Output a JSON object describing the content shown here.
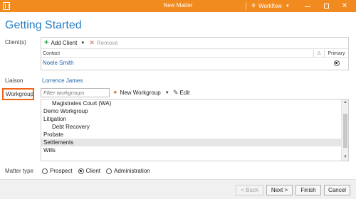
{
  "window": {
    "title": "New Matter",
    "workflow_label": "Workflow",
    "app_icon": "book-icon"
  },
  "page": {
    "heading": "Getting Started"
  },
  "clients": {
    "label": "Client(s)",
    "add_label": "Add Client",
    "remove_label": "Remove",
    "col_contact": "Contact",
    "col_warning": "⚠",
    "col_primary": "Primary",
    "rows": [
      {
        "name": "Noele Smith",
        "primary": true
      }
    ]
  },
  "liaison": {
    "label": "Liaison",
    "value": "Lorrence James"
  },
  "workgroup": {
    "label": "Workgroup",
    "filter_placeholder": "Filter workgroups",
    "new_label": "New Workgroup",
    "edit_label": "Edit",
    "items": [
      {
        "label": "Magistrates Court (WA)",
        "child": true,
        "selected": false
      },
      {
        "label": "Demo Workgroup",
        "child": false,
        "selected": false
      },
      {
        "label": "Litigation",
        "child": false,
        "selected": false
      },
      {
        "label": "Debt Recovery",
        "child": true,
        "selected": false
      },
      {
        "label": "Probate",
        "child": false,
        "selected": false
      },
      {
        "label": "Settlements",
        "child": false,
        "selected": true
      },
      {
        "label": "Wills",
        "child": false,
        "selected": false
      }
    ]
  },
  "matter_type": {
    "label": "Matter type",
    "options": [
      {
        "label": "Prospect",
        "checked": false
      },
      {
        "label": "Client",
        "checked": true
      },
      {
        "label": "Administration",
        "checked": false
      }
    ]
  },
  "footer": {
    "back_label": "< Back",
    "next_label": "Next >",
    "finish_label": "Finish",
    "cancel_label": "Cancel"
  },
  "colors": {
    "titlebar": "#f18a1f",
    "heading": "#2a7ec2",
    "link": "#1a64b0",
    "highlight_border": "#f06418"
  }
}
